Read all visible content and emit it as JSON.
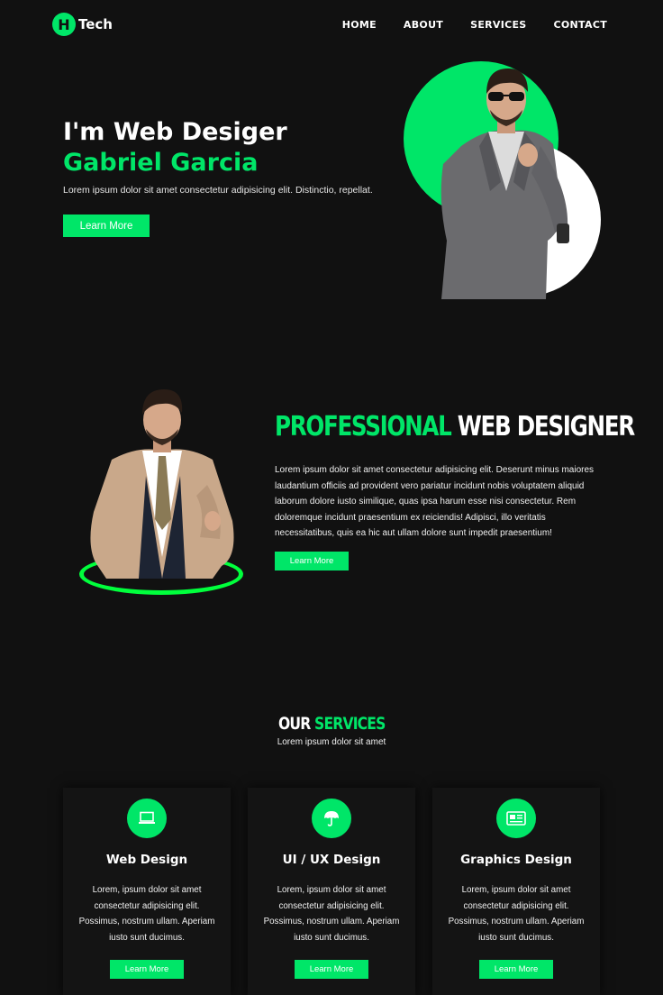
{
  "brand": {
    "logo_letter": "H",
    "name": "Tech",
    "accent": "#00e668"
  },
  "nav": {
    "items": [
      "HOME",
      "ABOUT",
      "SERVICES",
      "CONTACT"
    ]
  },
  "hero": {
    "title": "I'm Web Desiger",
    "name": "Gabriel Garcia",
    "description": "Lorem ipsum dolor sit amet consectetur adipisicing elit. Distinctio, repellat.",
    "button": "Learn More"
  },
  "about": {
    "title_green": "PROFESSIONAL",
    "title_white": "WEB DESIGNER",
    "description": "Lorem ipsum dolor sit amet consectetur adipisicing elit. Deserunt minus maiores laudantium officiis ad provident vero pariatur incidunt nobis voluptatem aliquid laborum dolore iusto similique, quas ipsa harum esse nisi consectetur. Rem doloremque incidunt praesentium ex reiciendis! Adipisci, illo veritatis necessitatibus, quis ea hic aut ullam dolore sunt impedit praesentium!",
    "button": "Learn More"
  },
  "services": {
    "title_white": "OUR",
    "title_green": "SERVICES",
    "subtitle": "Lorem ipsum dolor sit amet",
    "cards": [
      {
        "icon": "laptop-icon",
        "title": "Web Design",
        "description": "Lorem, ipsum dolor sit amet consectetur adipisicing elit. Possimus, nostrum ullam. Aperiam iusto sunt ducimus.",
        "button": "Learn More"
      },
      {
        "icon": "umbrella-icon",
        "title": "UI / UX Design",
        "description": "Lorem, ipsum dolor sit amet consectetur adipisicing elit. Possimus, nostrum ullam. Aperiam iusto sunt ducimus.",
        "button": "Learn More"
      },
      {
        "icon": "newspaper-icon",
        "title": "Graphics Design",
        "description": "Lorem, ipsum dolor sit amet consectetur adipisicing elit. Possimus, nostrum ullam. Aperiam iusto sunt ducimus.",
        "button": "Learn More"
      }
    ]
  }
}
